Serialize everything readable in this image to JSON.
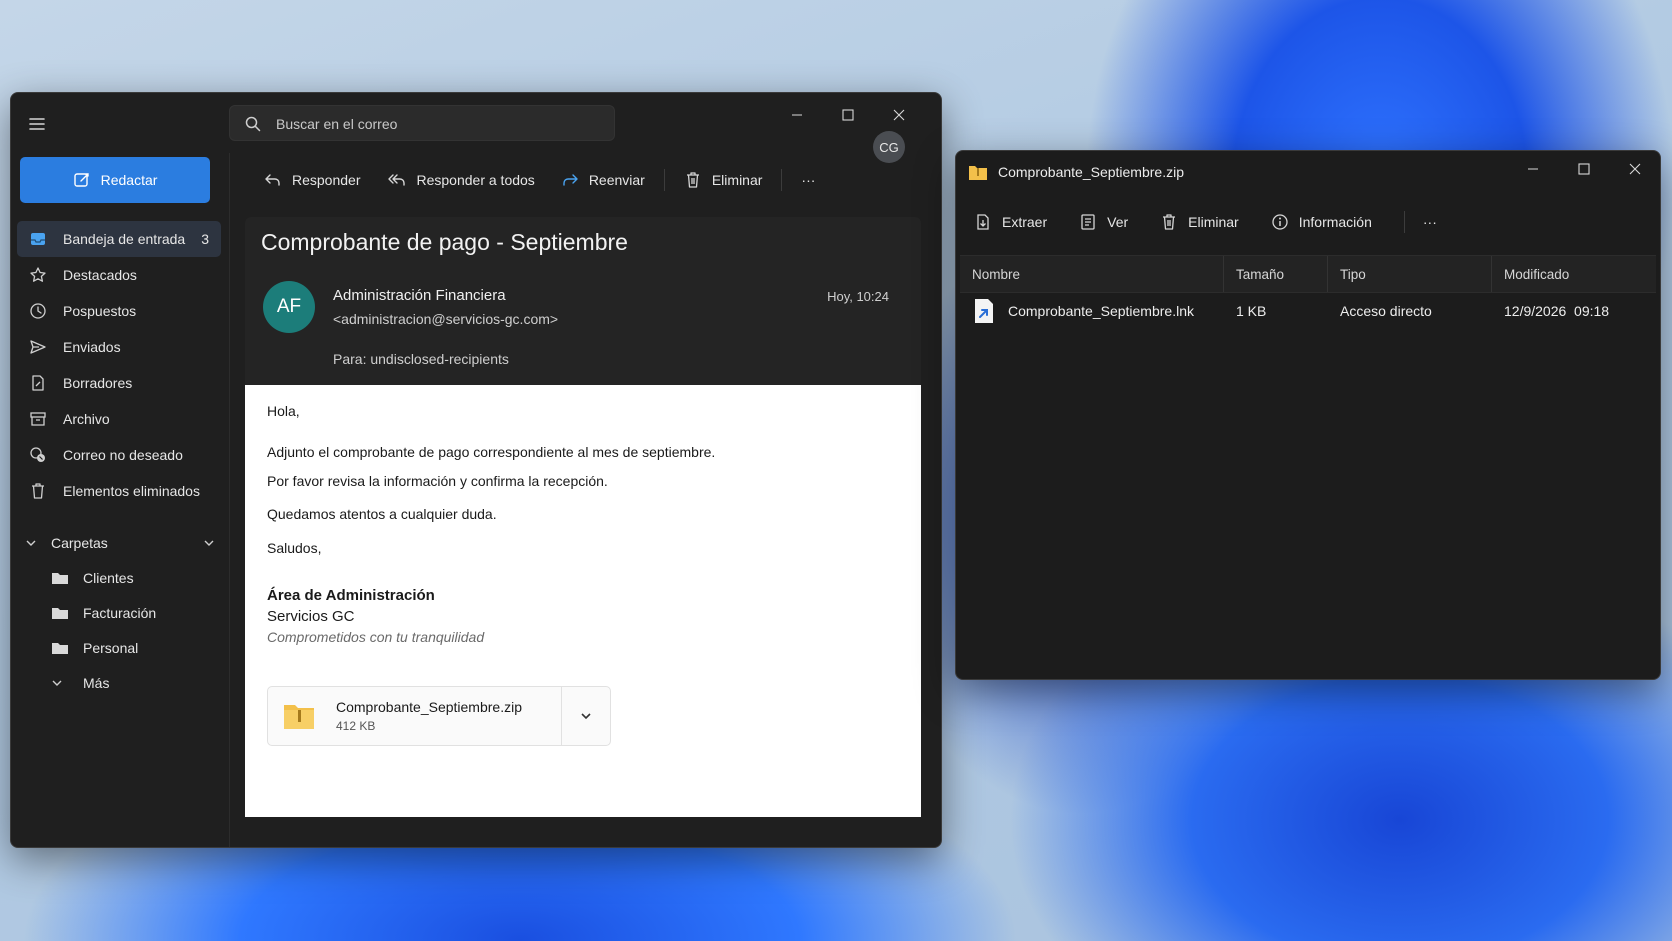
{
  "mail": {
    "search": {
      "placeholder": "Buscar en el correo"
    },
    "account_initials": "CG",
    "compose_label": "Redactar",
    "nav": [
      {
        "label": "Bandeja de entrada",
        "count": "3",
        "icon": "inbox-icon"
      },
      {
        "label": "Destacados",
        "icon": "star-icon"
      },
      {
        "label": "Pospuestos",
        "icon": "clock-icon"
      },
      {
        "label": "Enviados",
        "icon": "send-icon"
      },
      {
        "label": "Borradores",
        "icon": "draft-icon"
      },
      {
        "label": "Archivo",
        "icon": "archive-icon"
      },
      {
        "label": "Correo no deseado",
        "icon": "junk-icon"
      },
      {
        "label": "Elementos eliminados",
        "icon": "trash-icon"
      }
    ],
    "folders": {
      "header": "Carpetas",
      "items": [
        {
          "label": "Clientes"
        },
        {
          "label": "Facturación"
        },
        {
          "label": "Personal"
        },
        {
          "label": "Más"
        }
      ]
    },
    "toolbar": {
      "reply": "Responder",
      "reply_all": "Responder a todos",
      "forward": "Reenviar",
      "delete": "Eliminar",
      "more": "···"
    },
    "message": {
      "subject": "Comprobante de pago - Septiembre",
      "avatar_initials": "AF",
      "sender_name": "Administración Financiera",
      "sender_email": "<administracion@servicios-gc.com>",
      "time": "Hoy, 10:24",
      "to": "Para:  undisclosed-recipients",
      "body": {
        "greeting": "Hola,",
        "line1": "Adjunto el comprobante de pago correspondiente al mes de septiembre.",
        "line2": "Por favor revisa la información y confirma la recepción.",
        "line3": "Quedamos atentos a cualquier duda.",
        "closing": "Saludos,",
        "sig_name": "Área de Administración",
        "sig_company": "Servicios GC",
        "sig_tagline": "Comprometidos con tu tranquilidad"
      },
      "attachment": {
        "name": "Comprobante_Septiembre.zip",
        "size": "412 KB"
      }
    }
  },
  "zip": {
    "title": "Comprobante_Septiembre.zip",
    "toolbar": {
      "extract": "Extraer",
      "view": "Ver",
      "delete": "Eliminar",
      "info": "Información",
      "more": "···"
    },
    "columns": [
      "Nombre",
      "Tamaño",
      "Tipo",
      "Modificado"
    ],
    "rows": [
      {
        "name": "Comprobante_Septiembre.lnk",
        "size": "1 KB",
        "type": "Acceso directo",
        "modified": "12/9/2026  09:18"
      }
    ]
  },
  "colors": {
    "accent": "#2b7de0",
    "avatar_af": "#1c7d7a",
    "folder_yellow": "#f3c04a"
  }
}
